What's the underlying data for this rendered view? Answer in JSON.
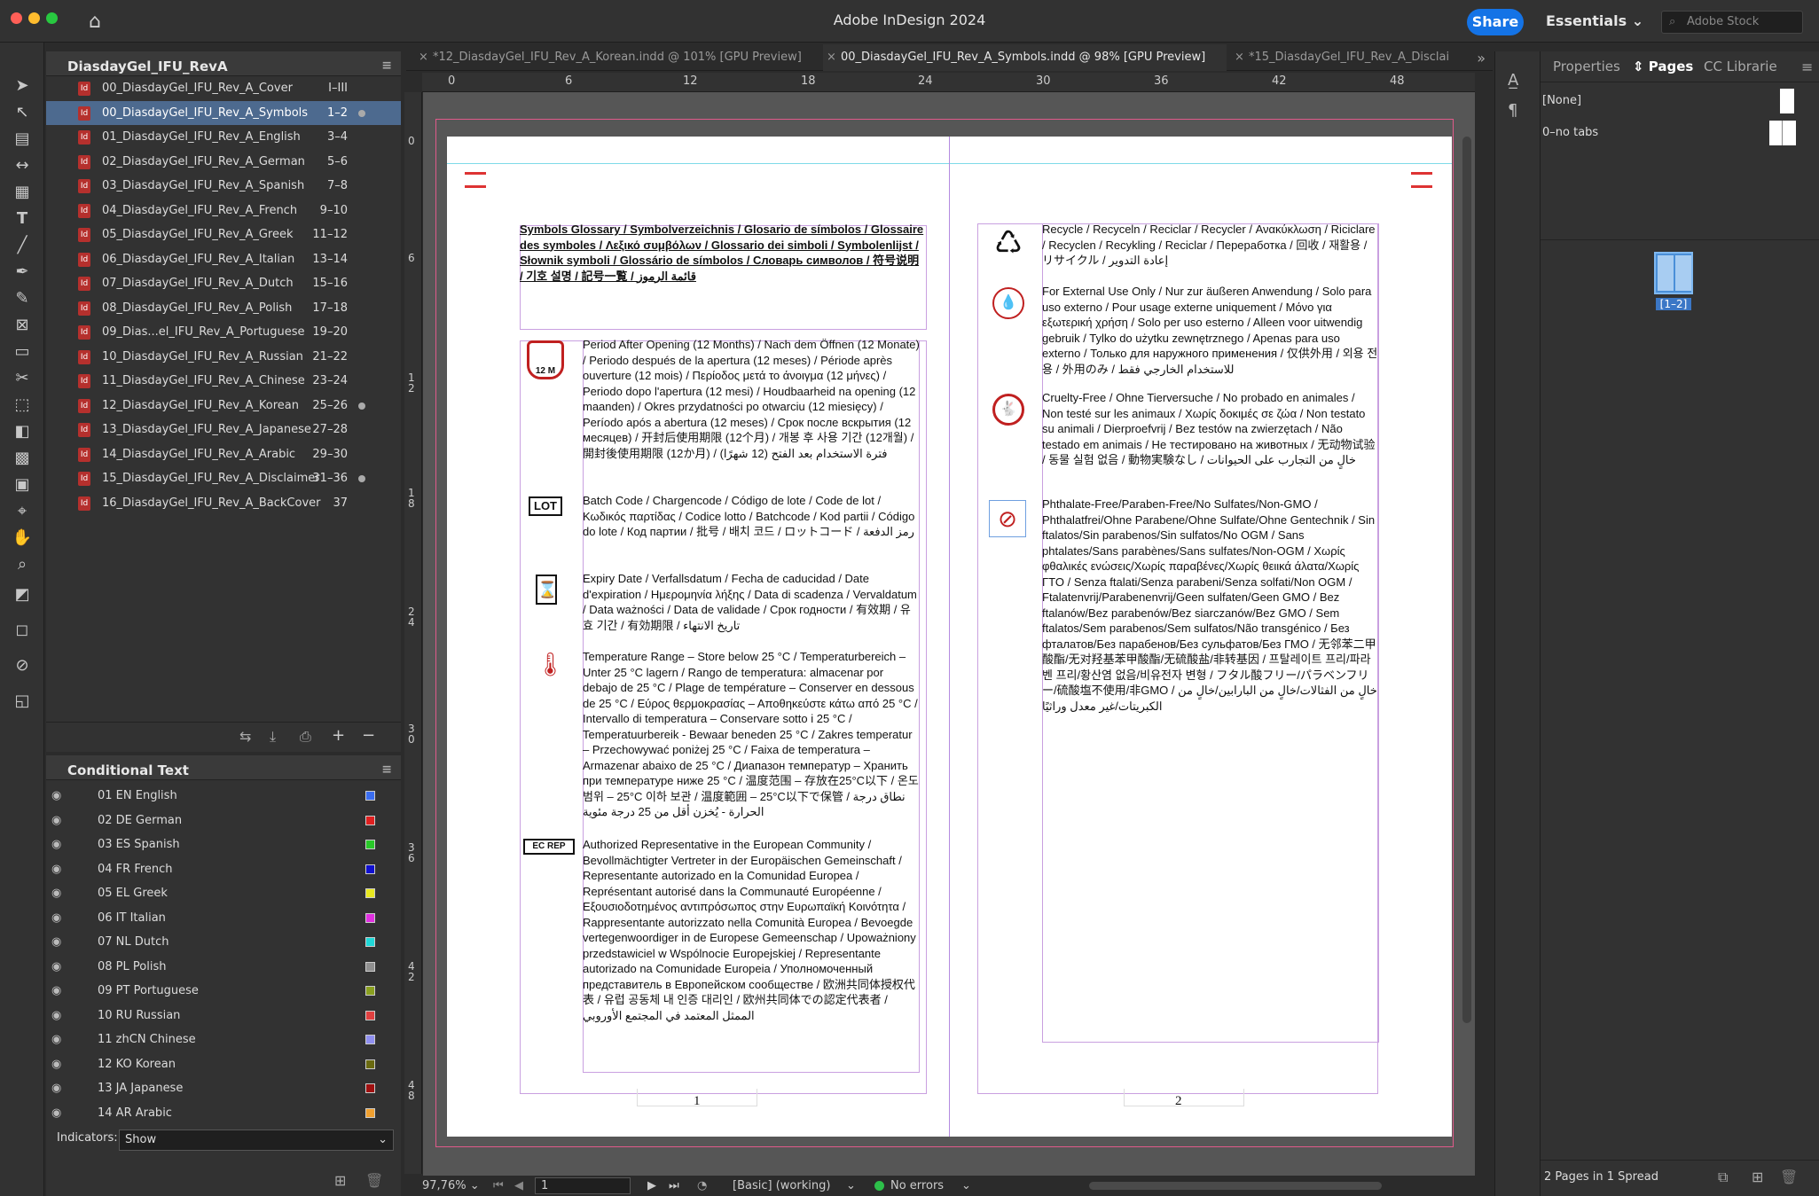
{
  "app": {
    "title": "Adobe InDesign 2024",
    "share": "Share",
    "workspace": "Essentials",
    "stock_placeholder": "Adobe Stock"
  },
  "book": {
    "name": "DiasdayGel_IFU_RevA",
    "items": [
      {
        "name": "00_DiasdayGel_IFU_Rev_A_Cover",
        "range": "I–III",
        "dot": false,
        "selected": false
      },
      {
        "name": "00_DiasdayGel_IFU_Rev_A_Symbols",
        "range": "1–2",
        "dot": true,
        "selected": true
      },
      {
        "name": "01_DiasdayGel_IFU_Rev_A_English",
        "range": "3–4",
        "dot": false,
        "selected": false
      },
      {
        "name": "02_DiasdayGel_IFU_Rev_A_German",
        "range": "5–6",
        "dot": false,
        "selected": false
      },
      {
        "name": "03_DiasdayGel_IFU_Rev_A_Spanish",
        "range": "7–8",
        "dot": false,
        "selected": false
      },
      {
        "name": "04_DiasdayGel_IFU_Rev_A_French",
        "range": "9–10",
        "dot": false,
        "selected": false
      },
      {
        "name": "05_DiasdayGel_IFU_Rev_A_Greek",
        "range": "11–12",
        "dot": false,
        "selected": false
      },
      {
        "name": "06_DiasdayGel_IFU_Rev_A_Italian",
        "range": "13–14",
        "dot": false,
        "selected": false
      },
      {
        "name": "07_DiasdayGel_IFU_Rev_A_Dutch",
        "range": "15–16",
        "dot": false,
        "selected": false
      },
      {
        "name": "08_DiasdayGel_IFU_Rev_A_Polish",
        "range": "17–18",
        "dot": false,
        "selected": false
      },
      {
        "name": "09_Dias...el_IFU_Rev_A_Portuguese",
        "range": "19–20",
        "dot": false,
        "selected": false
      },
      {
        "name": "10_DiasdayGel_IFU_Rev_A_Russian",
        "range": "21–22",
        "dot": false,
        "selected": false
      },
      {
        "name": "11_DiasdayGel_IFU_Rev_A_Chinese",
        "range": "23–24",
        "dot": false,
        "selected": false
      },
      {
        "name": "12_DiasdayGel_IFU_Rev_A_Korean",
        "range": "25–26",
        "dot": true,
        "selected": false
      },
      {
        "name": "13_DiasdayGel_IFU_Rev_A_Japanese",
        "range": "27–28",
        "dot": false,
        "selected": false
      },
      {
        "name": "14_DiasdayGel_IFU_Rev_A_Arabic",
        "range": "29–30",
        "dot": false,
        "selected": false
      },
      {
        "name": "15_DiasdayGel_IFU_Rev_A_Disclaimer",
        "range": "31–36",
        "dot": true,
        "selected": false
      },
      {
        "name": "16_DiasdayGel_IFU_Rev_A_BackCover",
        "range": "37",
        "dot": false,
        "selected": false
      }
    ]
  },
  "conditional": {
    "title": "Conditional Text",
    "indicators_label": "Indicators:",
    "indicators_value": "Show",
    "items": [
      {
        "name": "01 EN English",
        "color": "#3a6df0"
      },
      {
        "name": "02 DE German",
        "color": "#e02020"
      },
      {
        "name": "03 ES Spanish",
        "color": "#28c828"
      },
      {
        "name": "04 FR French",
        "color": "#1010d0"
      },
      {
        "name": "05 EL Greek",
        "color": "#e8e820"
      },
      {
        "name": "06 IT Italian",
        "color": "#e030e0"
      },
      {
        "name": "07 NL Dutch",
        "color": "#20d8d8"
      },
      {
        "name": "08 PL Polish",
        "color": "#909090"
      },
      {
        "name": "09 PT Portuguese",
        "color": "#8aa020"
      },
      {
        "name": "10 RU Russian",
        "color": "#e04040"
      },
      {
        "name": "11 zhCN Chinese",
        "color": "#9090f0"
      },
      {
        "name": "12 KO Korean",
        "color": "#6a6a10"
      },
      {
        "name": "13 JA Japanese",
        "color": "#a01010"
      },
      {
        "name": "14 AR Arabic",
        "color": "#f0a030"
      }
    ]
  },
  "tabs": [
    {
      "label": "*12_DiasdayGel_IFU_Rev_A_Korean.indd @ 101% [GPU Preview]",
      "active": false
    },
    {
      "label": "00_DiasdayGel_IFU_Rev_A_Symbols.indd @ 98% [GPU Preview]",
      "active": true
    },
    {
      "label": "*15_DiasdayGel_IFU_Rev_A_Disclai",
      "active": false
    }
  ],
  "ruler": {
    "h": [
      "0",
      "6",
      "12",
      "18",
      "24",
      "30",
      "36",
      "42",
      "48"
    ],
    "v": [
      "0",
      "6",
      "1 2",
      "1 8",
      "2 4",
      "3 0",
      "3 6",
      "4 2",
      "4 8"
    ]
  },
  "doc": {
    "heading": "Symbols Glossary / Symbolverzeichnis / Glosario de símbolos / Glossaire des symboles / Λεξικό συμβόλων / Glossario dei simboli / Symbolenlijst / Słownik symboli / Glossário de símbolos / Словарь символов / 符号说明 / 기호 설명 / 記号一覧 / قائمة الرموز",
    "entries_left": [
      {
        "sym": "12 M",
        "text": "Period After Opening (12 Months) / Nach dem Öffnen (12 Monate) / Periodo después de la apertura (12 meses) / Période après ouverture (12 mois) / Περίοδος μετά το άνοιγμα (12 μήνες) / Periodo dopo l'apertura (12 mesi) / Houdbaarheid na opening (12 maanden) / Okres przydatności po otwarciu (12 miesięcy) / Período após a abertura (12 meses) / Срок после вскрытия (12 месяцев) / 开封后使用期限 (12个月) / 개봉 후 사용 기간 (12개월) / 開封後使用期限 (12か月) / فترة الاستخدام بعد الفتح (12 شهرًا)"
      },
      {
        "sym": "LOT",
        "text": "Batch Code / Chargencode / Código de lote / Code de lot / Κωδικός παρτίδας / Codice lotto / Batchcode / Kod partii / Código do lote / Код партии / 批号 / 배치 코드 / ロットコード / رمز الدفعة"
      },
      {
        "sym": "⌛",
        "text": "Expiry Date / Verfallsdatum / Fecha de caducidad / Date d'expiration / Ημερομηνία λήξης / Data di scadenza / Vervaldatum / Data ważności / Data de validade / Срок годности / 有效期 / 유효 기간 / 有効期限 / تاريخ الانتهاء"
      },
      {
        "sym": "🌡",
        "text": "Temperature Range – Store below 25 °C / Temperaturbereich – Unter 25 °C lagern / Rango de temperatura: almacenar por debajo de 25 °C / Plage de température – Conserver en dessous de 25 °C / Εύρος θερμοκρασίας – Αποθηκεύστε κάτω από 25 °C / Intervallo di temperatura – Conservare sotto i 25 °C / Temperatuurbereik - Bewaar beneden 25 °C / Zakres temperatur – Przechowywać poniżej 25 °C / Faixa de temperatura – Armazenar abaixo de 25 °C / Диапазон температур – Хранить при температуре ниже 25 °C / 温度范围 – 存放在25°C以下 / 온도 범위 – 25°C 이하 보관 / 温度範囲 – 25°C以下で保管 / نطاق درجة الحرارة - يُخزن أقل من 25 درجة مئوية"
      },
      {
        "sym": "EC REP",
        "text": "Authorized Representative in the European Community / Bevollmächtigter Vertreter in der Europäischen Gemeinschaft / Representante autorizado en la Comunidad Europea / Représentant autorisé dans la Communauté Européenne / Εξουσιοδοτημένος αντιπρόσωπος στην Ευρωπαϊκή Κοινότητα / Rappresentante autorizzato nella Comunità Europea / Bevoegde vertegenwoordiger in de Europese Gemeenschap / Upoważniony przedstawiciel w Wspólnocie Europejskiej / Representante autorizado na Comunidade Europeia / Уполномоченный представитель в Европейском сообществе / 欧洲共同体授权代表 / 유럽 공동체 내 인증 대리인 / 欧州共同体での認定代表者 / الممثل المعتمد في المجتمع الأوروبي"
      }
    ],
    "entries_right": [
      {
        "sym": "♺",
        "text": "Recycle / Recyceln / Reciclar / Recycler / Ανακύκλωση / Riciclare / Recyclen / Recykling / Reciclar / Переработка / 回收 / 재활용 / リサイクル / إعادة التدوير"
      },
      {
        "sym": "💧",
        "text": "For External Use Only / Nur zur äußeren Anwendung / Solo para uso externo / Pour usage externe uniquement / Μόνο για εξωτερική χρήση / Solo per uso esterno / Alleen voor uitwendig gebruik / Tylko do użytku zewnętrznego / Apenas para uso externo / Только для наружного применения / 仅供外用 / 외용 전용 / 外用のみ / للاستخدام الخارجي فقط"
      },
      {
        "sym": "🐇",
        "text": "Cruelty-Free / Ohne Tierversuche / No probado en animales / Non testé sur les animaux / Χωρίς δοκιμές σε ζώα / Non testato su animali / Dierproefvrij / Bez testów na zwierzętach / Não testado em animais / Не тестировано на животных / 无动物试验 / 동물 실험 없음 / 動物実験なし / خالٍ من التجارب على الحيوانات"
      },
      {
        "sym": "⊘",
        "text": "Phthalate-Free/Paraben-Free/No Sulfates/Non-GMO / Phthalatfrei/Ohne Parabene/Ohne Sulfate/Ohne Gentechnik / Sin ftalatos/Sin parabenos/Sin sulfatos/No OGM / Sans phtalates/Sans parabènes/Sans sulfates/Non-OGM / Χωρίς φθαλικές ενώσεις/Χωρίς παραβένες/Χωρίς θειικά άλατα/Χωρίς ΓΤΟ / Senza ftalati/Senza parabeni/Senza solfati/Non OGM / Ftalatenvrij/Parabenenvrij/Geen sulfaten/Geen GMO / Bez ftalanów/Bez parabenów/Bez siarczanów/Bez GMO / Sem ftalatos/Sem parabenos/Sem sulfatos/Não transgénico / Без фталатов/Без парабенов/Без сульфатов/Без ГМО / 无邻苯二甲酸酯/无对羟基苯甲酸酯/无硫酸盐/非转基因 / 프탈레이트 프리/파라벤 프리/황산염 없음/비유전자 변형 / フタル酸フリー/パラベンフリー/硫酸塩不使用/非GMO / خالٍ من الفثالات/خالٍ من البارابين/خالٍ من الكبريتات/غير معدل وراثيًا"
      }
    ],
    "page1": "1",
    "page2": "2"
  },
  "status": {
    "zoom": "97,76%",
    "page": "1",
    "style": "[Basic] (working)",
    "errors": "No errors"
  },
  "right_panel": {
    "tabs": [
      "Properties",
      "Pages",
      "CC Librarie"
    ],
    "masters": [
      "[None]",
      "0–no tabs"
    ],
    "spread_label": "[1–2]",
    "footer": "2 Pages in 1 Spread"
  }
}
